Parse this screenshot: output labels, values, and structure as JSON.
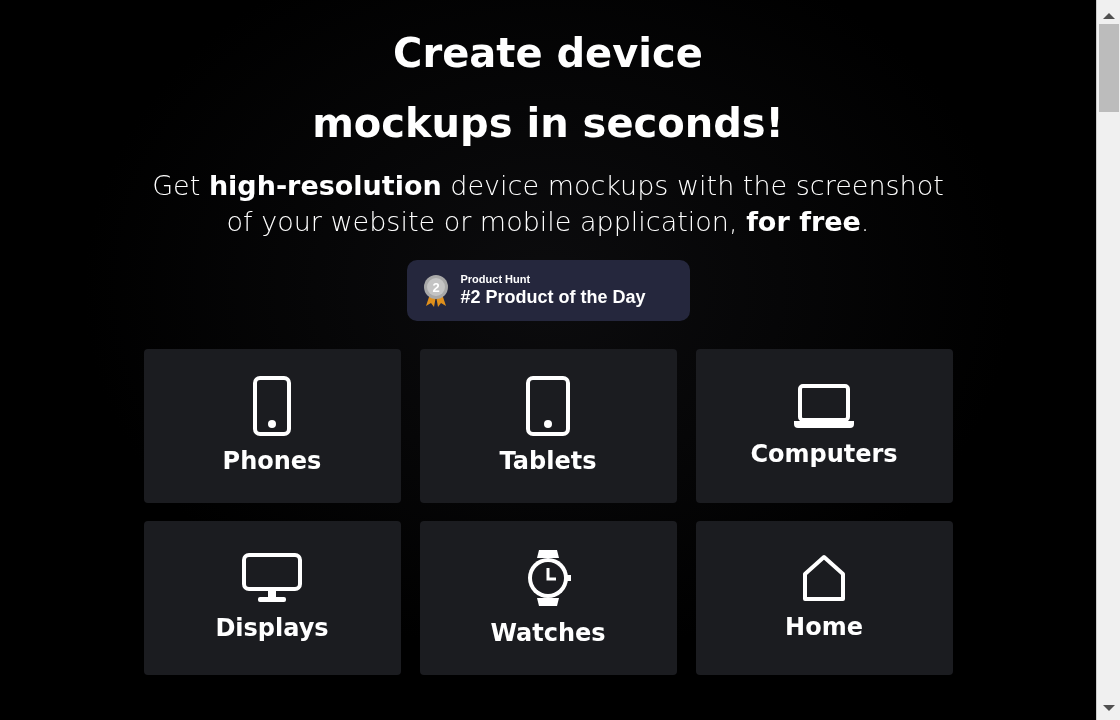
{
  "hero": {
    "title": "Create device mockups in seconds!",
    "subtitle": "Get **high-resolution** device mockups with the screenshot of your website or mobile application, **for free**."
  },
  "award": {
    "source": "Product Hunt",
    "title": "#2 Product of the Day",
    "medal": "2"
  },
  "categories": [
    {
      "label": "Phones",
      "kind": "phone"
    },
    {
      "label": "Tablets",
      "kind": "tablet"
    },
    {
      "label": "Computers",
      "kind": "laptop"
    },
    {
      "label": "Displays",
      "kind": "monitor"
    },
    {
      "label": "Watches",
      "kind": "watch"
    },
    {
      "label": "Home",
      "kind": "house"
    }
  ]
}
